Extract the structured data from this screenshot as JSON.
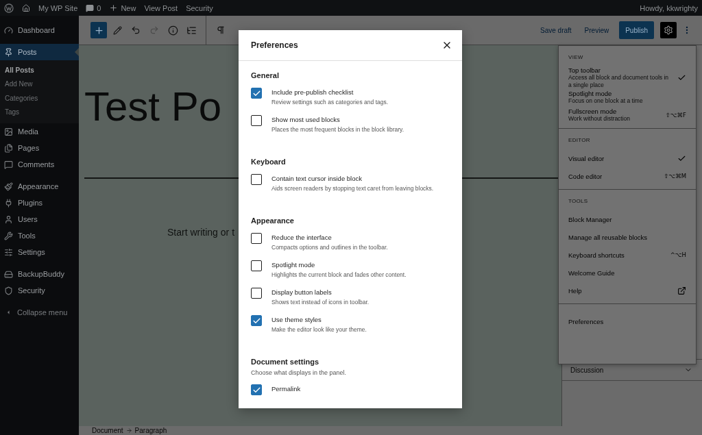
{
  "admin_bar": {
    "site": "My WP Site",
    "comments": "0",
    "new": "New",
    "links": [
      "View Post",
      "Security"
    ],
    "greeting": "Howdy, kkwrighty"
  },
  "sidebar": {
    "groups": [
      [
        {
          "label": "Dashboard",
          "selected": false
        }
      ],
      [
        {
          "label": "Posts",
          "selected": true,
          "children": [
            {
              "label": "All Posts",
              "selected": true
            },
            {
              "label": "Add New",
              "selected": false
            },
            {
              "label": "Categories",
              "selected": false
            },
            {
              "label": "Tags",
              "selected": false
            }
          ]
        },
        {
          "label": "Media",
          "selected": false
        },
        {
          "label": "Pages",
          "selected": false
        },
        {
          "label": "Comments",
          "selected": false
        }
      ],
      [
        {
          "label": "Appearance",
          "selected": false
        },
        {
          "label": "Plugins",
          "selected": false
        },
        {
          "label": "Users",
          "selected": false
        },
        {
          "label": "Tools",
          "selected": false
        },
        {
          "label": "Settings",
          "selected": false
        }
      ],
      [
        {
          "label": "BackupBuddy",
          "selected": false
        },
        {
          "label": "Security",
          "selected": false
        }
      ]
    ],
    "collapse": "Collapse menu"
  },
  "editor": {
    "save_draft": "Save draft",
    "preview": "Preview",
    "publish": "Publish",
    "settings_active": true,
    "title": "Test Po",
    "paragraph_placeholder": "Start writing or t",
    "breadcrumb": [
      "Document",
      "Paragraph"
    ],
    "sidebar_panels": [
      {
        "label": "Discussion",
        "expanded": false
      }
    ]
  },
  "options_menu": {
    "sections": [
      {
        "heading": "VIEW",
        "items": [
          {
            "label": "Top toolbar",
            "description": "Access all block and document tools in a single place",
            "checked": true
          },
          {
            "label": "Spotlight mode",
            "description": "Focus on one block at a time",
            "checked": false
          },
          {
            "label": "Fullscreen mode",
            "description": "Work without distraction",
            "checked": false,
            "shortcut": "⇧⌥⌘F"
          }
        ]
      },
      {
        "heading": "EDITOR",
        "items": [
          {
            "label": "Visual editor",
            "checked": true
          },
          {
            "label": "Code editor",
            "checked": false,
            "shortcut": "⇧⌥⌘M"
          }
        ]
      },
      {
        "heading": "TOOLS",
        "items": [
          {
            "label": "Block Manager",
            "checked": false
          },
          {
            "label": "Manage all reusable blocks",
            "checked": false
          },
          {
            "label": "Keyboard shortcuts",
            "checked": false,
            "shortcut": "^⌥H"
          },
          {
            "label": "Welcome Guide",
            "checked": false
          },
          {
            "label": "Help",
            "checked": false,
            "kind": "external"
          }
        ]
      },
      {
        "items": [
          {
            "label": "Preferences",
            "checked": false
          }
        ]
      }
    ]
  },
  "modal": {
    "title": "Preferences",
    "sections": [
      {
        "heading": "General",
        "options": [
          {
            "label": "Include pre-publish checklist",
            "description": "Review settings such as categories and tags.",
            "checked": true
          },
          {
            "label": "Show most used blocks",
            "description": "Places the most frequent blocks in the block library.",
            "checked": false
          }
        ]
      },
      {
        "heading": "Keyboard",
        "options": [
          {
            "label": "Contain text cursor inside block",
            "description": "Aids screen readers by stopping text caret from leaving blocks.",
            "checked": false
          }
        ]
      },
      {
        "heading": "Appearance",
        "options": [
          {
            "label": "Reduce the interface",
            "description": "Compacts options and outlines in the toolbar.",
            "checked": false
          },
          {
            "label": "Spotlight mode",
            "description": "Highlights the current block and fades other content.",
            "checked": false
          },
          {
            "label": "Display button labels",
            "description": "Shows text instead of icons in toolbar.",
            "checked": false
          },
          {
            "label": "Use theme styles",
            "description": "Make the editor look like your theme.",
            "checked": true
          }
        ]
      },
      {
        "heading": "Document settings",
        "description": "Choose what displays in the panel.",
        "options": [
          {
            "label": "Permalink",
            "checked": true
          }
        ]
      }
    ]
  }
}
